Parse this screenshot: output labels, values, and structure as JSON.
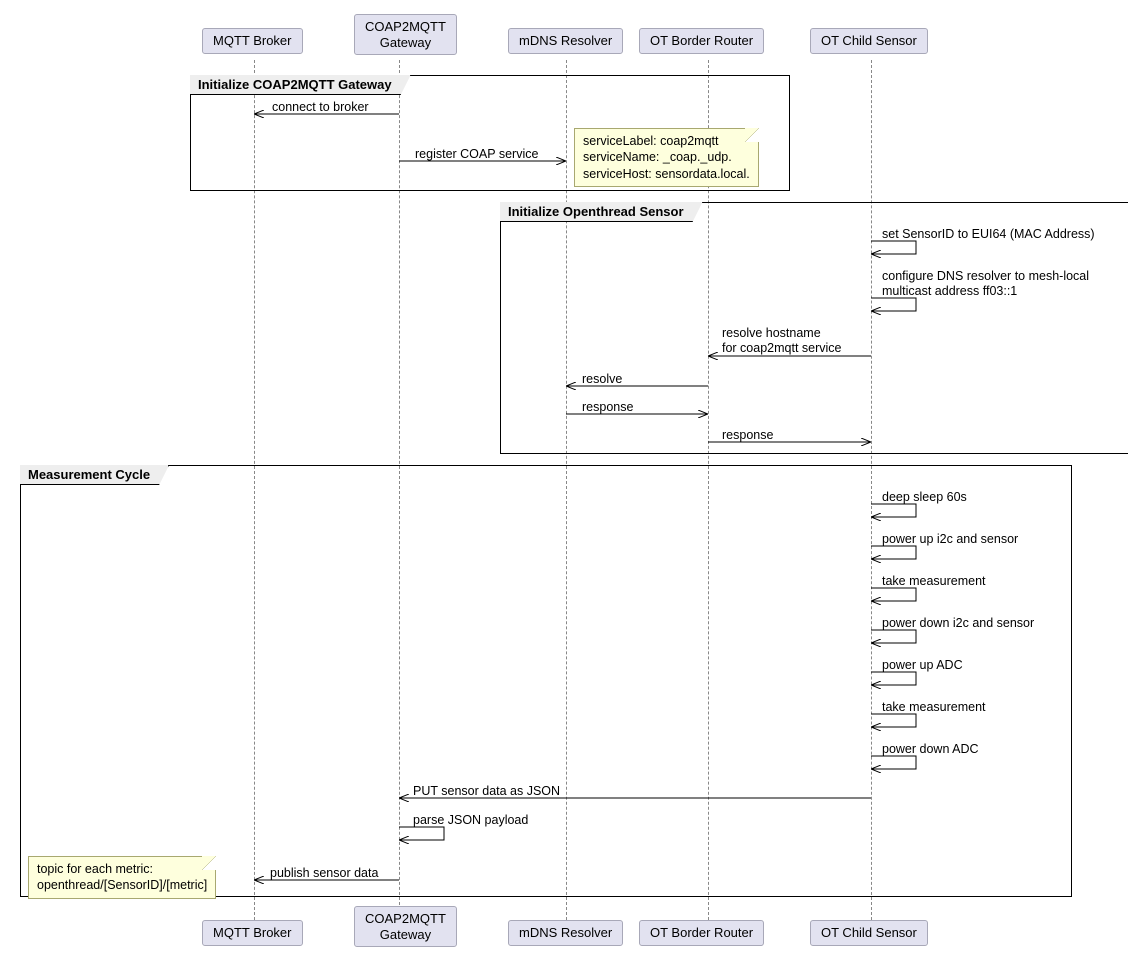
{
  "participants": {
    "p1": "MQTT Broker",
    "p2": "COAP2MQTT\nGateway",
    "p3": "mDNS Resolver",
    "p4": "OT Border Router",
    "p5": "OT Child Sensor"
  },
  "groups": {
    "g1": "Initialize COAP2MQTT Gateway",
    "g2": "Initialize Openthread Sensor",
    "g3": "Measurement Cycle"
  },
  "messages": {
    "m1": "connect to broker",
    "m2": "register COAP service",
    "m3": "set SensorID to EUI64 (MAC Address)",
    "m4": "configure DNS resolver to mesh-local\nmulticast address ff03::1",
    "m5": "resolve hostname\nfor coap2mqtt service",
    "m6": "resolve",
    "m7": "response",
    "m8": "response",
    "m9": "deep sleep 60s",
    "m10": "power up i2c and sensor",
    "m11": "take measurement",
    "m12": "power down i2c and sensor",
    "m13": "power up ADC",
    "m14": "take measurement",
    "m15": "power down ADC",
    "m16": "PUT sensor data as JSON",
    "m17": "parse JSON payload",
    "m18": "publish sensor data"
  },
  "notes": {
    "n1": "serviceLabel: coap2mqtt\nserviceName: _coap._udp.\nserviceHost: sensordata.local.",
    "n2": "topic for each metric:\nopenthread/[SensorID]/[metric]"
  }
}
